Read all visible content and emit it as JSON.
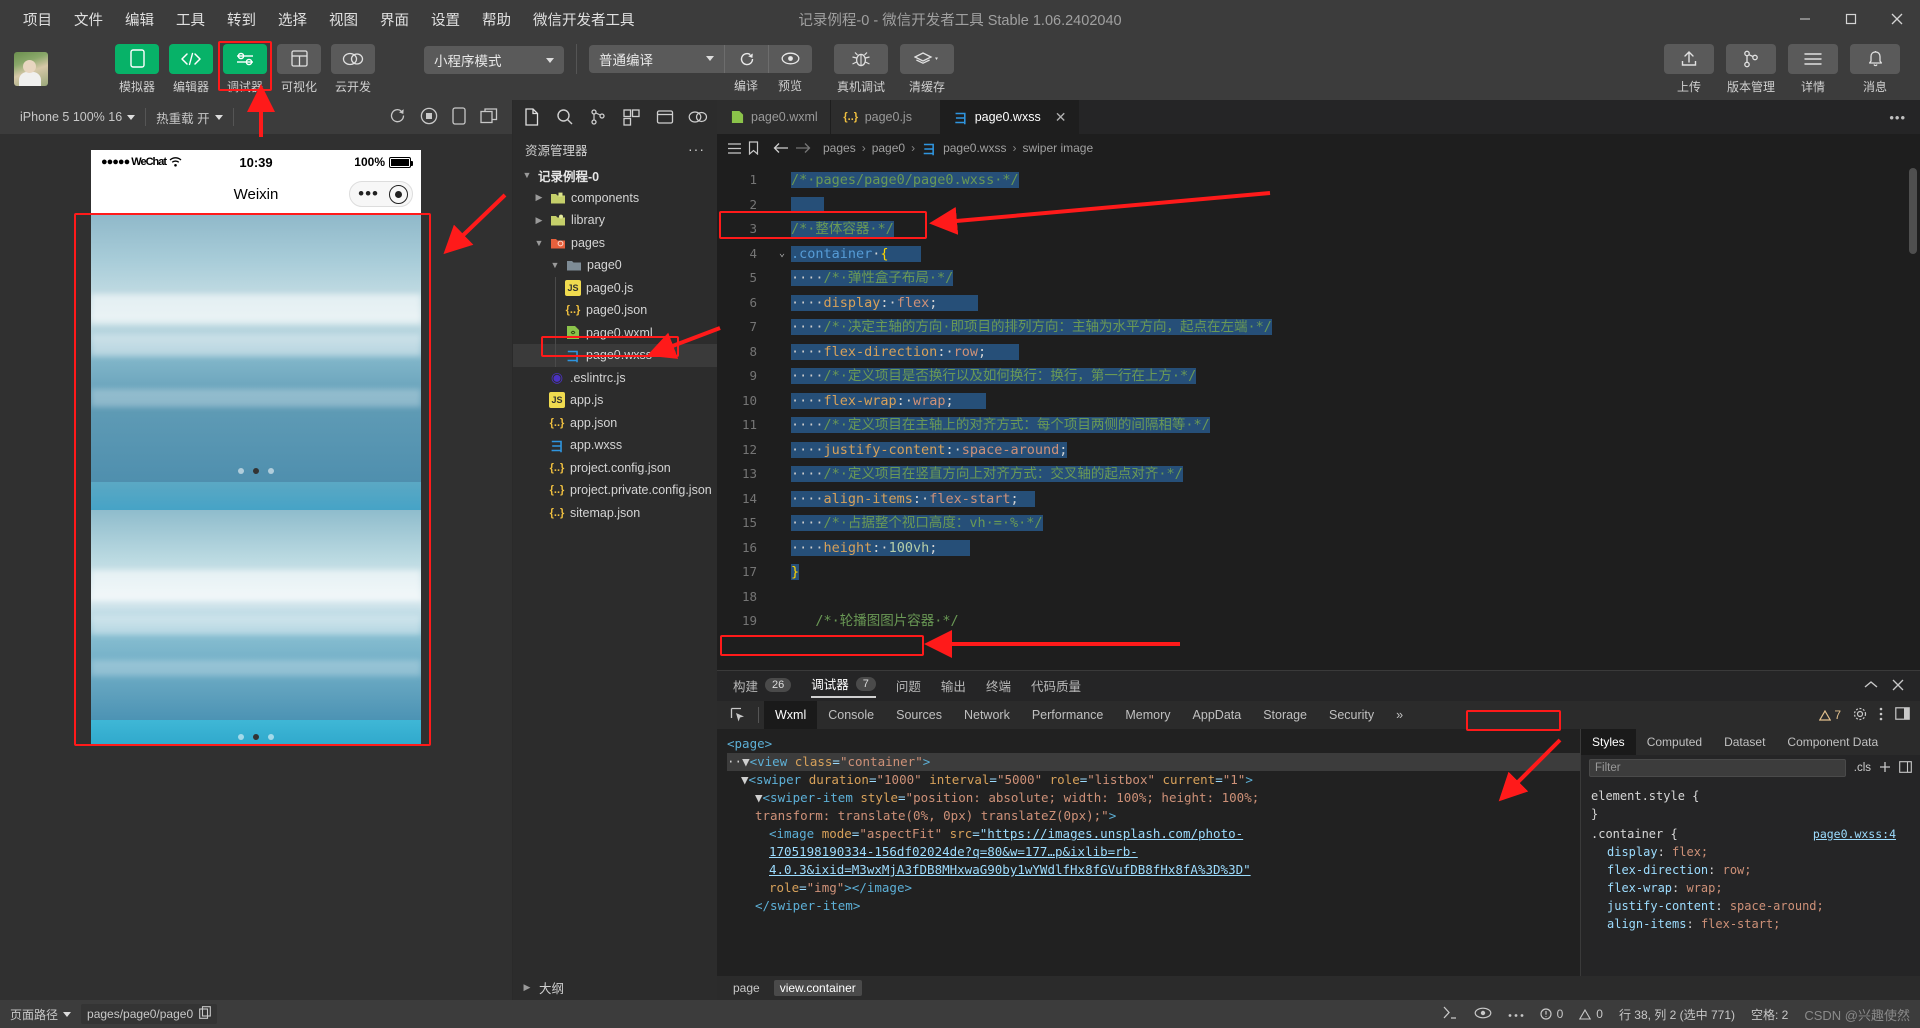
{
  "window": {
    "title": "记录例程-0 - 微信开发者工具 Stable 1.06.2402040",
    "minimize": "—",
    "maximize": "□",
    "close": "✕"
  },
  "menubar": [
    "项目",
    "文件",
    "编辑",
    "工具",
    "转到",
    "选择",
    "视图",
    "界面",
    "设置",
    "帮助",
    "微信开发者工具"
  ],
  "toolbar": {
    "buttons": [
      {
        "label": "模拟器",
        "icon": "phone-icon",
        "green": true
      },
      {
        "label": "编辑器",
        "icon": "code-icon",
        "green": true
      },
      {
        "label": "调试器",
        "icon": "sliders-icon",
        "green": true
      },
      {
        "label": "可视化",
        "icon": "layout-grid-icon",
        "green": false
      },
      {
        "label": "云开发",
        "icon": "cloud-icon",
        "green": false
      }
    ],
    "mode_select": "小程序模式",
    "compile_select": "普通编译",
    "compile_label": "编译",
    "preview_label": "预览",
    "realdevice_label": "真机调试",
    "clearcache_label": "清缓存",
    "right_buttons": [
      {
        "label": "上传",
        "icon": "upload-icon"
      },
      {
        "label": "版本管理",
        "icon": "git-branch-icon"
      },
      {
        "label": "详情",
        "icon": "hamburger-icon"
      },
      {
        "label": "消息",
        "icon": "bell-icon"
      }
    ]
  },
  "simulator": {
    "device_select": "iPhone 5 100% 16",
    "hotreload_select": "热重载 开",
    "refresh_icon": "refresh-icon",
    "stop_icon": "stop-record-icon",
    "phone_icon": "phone-outline-icon",
    "copy_icon": "multiscreen-icon",
    "status_carrier": "●●●●● WeChat",
    "status_time": "10:39",
    "status_battery": "100%",
    "nav_title": "Weixin",
    "dots_menu": "•••"
  },
  "explorer": {
    "tabs": [
      "files-icon",
      "search-icon",
      "scm-icon",
      "extensions-icon",
      "debug-icon",
      "cloud-icon"
    ],
    "header": "资源管理器",
    "more": "···",
    "root": "记录例程-0",
    "items": [
      {
        "name": "components",
        "type": "folder",
        "indent": 1,
        "arrow": "▶"
      },
      {
        "name": "library",
        "type": "folder",
        "indent": 1,
        "arrow": "▶"
      },
      {
        "name": "pages",
        "type": "folder-pages",
        "indent": 1,
        "arrow": "▼"
      },
      {
        "name": "page0",
        "type": "folder-open",
        "indent": 2,
        "arrow": "▼"
      },
      {
        "name": "page0.js",
        "type": "js",
        "indent": 3,
        "arrow": ""
      },
      {
        "name": "page0.json",
        "type": "json",
        "indent": 3,
        "arrow": ""
      },
      {
        "name": "page0.wxml",
        "type": "wxml",
        "indent": 3,
        "arrow": ""
      },
      {
        "name": "page0.wxss",
        "type": "wxss",
        "indent": 3,
        "arrow": "",
        "selected": true
      },
      {
        "name": ".eslintrc.js",
        "type": "eslint",
        "indent": 2,
        "arrow": ""
      },
      {
        "name": "app.js",
        "type": "js",
        "indent": 2,
        "arrow": ""
      },
      {
        "name": "app.json",
        "type": "json",
        "indent": 2,
        "arrow": ""
      },
      {
        "name": "app.wxss",
        "type": "wxss",
        "indent": 2,
        "arrow": ""
      },
      {
        "name": "project.config.json",
        "type": "json",
        "indent": 2,
        "arrow": ""
      },
      {
        "name": "project.private.config.json",
        "type": "json",
        "indent": 2,
        "arrow": ""
      },
      {
        "name": "sitemap.json",
        "type": "json",
        "indent": 2,
        "arrow": ""
      }
    ],
    "outline": "大纲"
  },
  "editor": {
    "tabs": [
      {
        "label": "page0.wxml",
        "type": "wxml",
        "active": false
      },
      {
        "label": "page0.js",
        "type": "js",
        "active": false
      },
      {
        "label": "page0.wxss",
        "type": "wxss",
        "active": true,
        "close": "✕"
      }
    ],
    "tabs_more": "•••",
    "breadcrumb": [
      "pages",
      "page0",
      "page0.wxss",
      "swiper image"
    ],
    "lines": [
      {
        "n": 1,
        "fold": "",
        "html": "<span class=\"hl tok-cmt\">/*·pages/page0/page0.wxss·*/</span>"
      },
      {
        "n": 2,
        "fold": "",
        "html": "<span class=\"hl\">&nbsp;&nbsp;&nbsp;&nbsp;</span>"
      },
      {
        "n": 3,
        "fold": "",
        "html": "<span class=\"hl tok-cmt\">/*·整体容器·*/</span>"
      },
      {
        "n": 4,
        "fold": "⌄",
        "html": "<span class=\"hl\"><span class=\"tok-sel\">.container</span><span class=\"tok-punc\">·</span><span class=\"tok-brace\">{</span>&nbsp;&nbsp;&nbsp;&nbsp;</span>"
      },
      {
        "n": 5,
        "fold": "",
        "html": "<span class=\"hl\">····<span class=\"tok-cmt\">/*·弹性盒子布局·*/</span></span>"
      },
      {
        "n": 6,
        "fold": "",
        "html": "<span class=\"hl\">····<span class=\"tok-prop\">display</span><span class=\"tok-punc\">:·</span><span class=\"tok-val\">flex</span><span class=\"tok-punc\">;</span>&nbsp;&nbsp;&nbsp;&nbsp;&nbsp;</span>"
      },
      {
        "n": 7,
        "fold": "",
        "html": "<span class=\"hl\">····<span class=\"tok-cmt\">/*·决定主轴的方向·即项目的排列方向：主轴为水平方向，起点在左端·*/</span></span>"
      },
      {
        "n": 8,
        "fold": "",
        "html": "<span class=\"hl\">····<span class=\"tok-prop\">flex-direction</span><span class=\"tok-punc\">:·</span><span class=\"tok-val\">row</span><span class=\"tok-punc\">;</span>&nbsp;&nbsp;&nbsp;&nbsp;</span>"
      },
      {
        "n": 9,
        "fold": "",
        "html": "<span class=\"hl\">····<span class=\"tok-cmt\">/*·定义项目是否换行以及如何换行：换行，第一行在上方·*/</span></span>"
      },
      {
        "n": 10,
        "fold": "",
        "html": "<span class=\"hl\">····<span class=\"tok-prop\">flex-wrap</span><span class=\"tok-punc\">:·</span><span class=\"tok-val\">wrap</span><span class=\"tok-punc\">;</span>&nbsp;&nbsp;&nbsp;&nbsp;</span>"
      },
      {
        "n": 11,
        "fold": "",
        "html": "<span class=\"hl\">····<span class=\"tok-cmt\">/*·定义项目在主轴上的对齐方式：每个项目两侧的间隔相等·*/</span></span>"
      },
      {
        "n": 12,
        "fold": "",
        "html": "<span class=\"hl\">····<span class=\"tok-prop\">justify-content</span><span class=\"tok-punc\">:·</span><span class=\"tok-val\">space-around</span><span class=\"tok-punc\">;</span></span>"
      },
      {
        "n": 13,
        "fold": "",
        "html": "<span class=\"hl\">····<span class=\"tok-cmt\">/*·定义项目在竖直方向上对齐方式：交叉轴的起点对齐·*/</span></span>"
      },
      {
        "n": 14,
        "fold": "",
        "html": "<span class=\"hl\">····<span class=\"tok-prop\">align-items</span><span class=\"tok-punc\">:·</span><span class=\"tok-val\">flex-start</span><span class=\"tok-punc\">;</span>&nbsp;&nbsp;</span>"
      },
      {
        "n": 15,
        "fold": "",
        "html": "<span class=\"hl\">····<span class=\"tok-cmt\">/*·占据整个视口高度：vh·=·%·*/</span></span>"
      },
      {
        "n": 16,
        "fold": "",
        "html": "<span class=\"hl\">····<span class=\"tok-prop\">height</span><span class=\"tok-punc\">:·</span><span class=\"tok-num\">100vh</span><span class=\"tok-punc\">;</span>&nbsp;&nbsp;&nbsp;&nbsp;</span>"
      },
      {
        "n": 17,
        "fold": "",
        "html": "<span class=\"hl tok-brace\">}</span>"
      },
      {
        "n": 18,
        "fold": "",
        "html": ""
      },
      {
        "n": 19,
        "fold": "",
        "html": "<span class=\"tok-cmt\">&nbsp;&nbsp;&nbsp;/*·轮播图图片容器·*/</span>"
      }
    ]
  },
  "devtools": {
    "head_tabs": [
      {
        "label": "构建",
        "badge": "26",
        "active": false
      },
      {
        "label": "调试器",
        "badge": "7",
        "active": true
      },
      {
        "label": "问题",
        "badge": "",
        "active": false
      },
      {
        "label": "输出",
        "badge": "",
        "active": false
      },
      {
        "label": "终端",
        "badge": "",
        "active": false
      },
      {
        "label": "代码质量",
        "badge": "",
        "active": false
      }
    ],
    "collapse_icon": "chevron-up-icon",
    "close_icon": "close-icon",
    "panel_tabs": [
      "Wxml",
      "Console",
      "Sources",
      "Network",
      "Performance",
      "Memory",
      "AppData",
      "Storage",
      "Security"
    ],
    "panel_active": "Wxml",
    "overflow": "»",
    "warning_count": "7",
    "settings_icon": "gear-icon",
    "kebab_icon": "kebab-icon",
    "dock_icon": "dock-icon",
    "picker_icon": "element-picker-icon",
    "wxml_lines": [
      {
        "indent": 0,
        "html": "<span class=\"t-tag\">&lt;page&gt;</span>"
      },
      {
        "indent": 0,
        "sel": true,
        "html": "<span class=\"t-plain\">··</span><span class=\"t-plain\">▼</span><span class=\"t-tag\">&lt;view</span> <span class=\"t-attr\">class</span>=<span class=\"t-str\">\"container\"</span><span class=\"t-tag\">&gt;</span>"
      },
      {
        "indent": 1,
        "html": "<span class=\"t-plain\">▼</span><span class=\"t-tag\">&lt;swiper</span> <span class=\"t-attr\">duration</span>=<span class=\"t-str\">\"1000\"</span> <span class=\"t-attr\">interval</span>=<span class=\"t-str\">\"5000\"</span> <span class=\"t-attr\">role</span>=<span class=\"t-str\">\"listbox\"</span> <span class=\"t-attr\">current</span>=<span class=\"t-str\">\"1\"</span><span class=\"t-tag\">&gt;</span>"
      },
      {
        "indent": 2,
        "html": "<span class=\"t-plain\">▼</span><span class=\"t-tag\">&lt;swiper-item</span> <span class=\"t-attr\">style</span>=<span class=\"t-str\">\"position: absolute; width: 100%; height: 100%;</span>"
      },
      {
        "indent": 2,
        "html": "<span class=\"t-str\">transform: translate(0%, 0px) translateZ(0px);\"</span><span class=\"t-tag\">&gt;</span>"
      },
      {
        "indent": 3,
        "html": "<span class=\"t-tag\">&lt;image</span> <span class=\"t-attr\">mode</span>=<span class=\"t-str\">\"aspectFit\"</span> <span class=\"t-attr\">src</span>=<span class=\"t-link\">\"https://images.unsplash.com/photo-</span>"
      },
      {
        "indent": 3,
        "html": "<span class=\"t-link\">1705198190334-156df02024de?q=80&amp;w=177…p&amp;ixlib=rb-</span>"
      },
      {
        "indent": 3,
        "html": "<span class=\"t-link\">4.0.3&amp;ixid=M3wxMjA3fDB8MHxwaG90by1wYWdlfHx8fGVufDB8fHx8fA%3D%3D\"</span>"
      },
      {
        "indent": 3,
        "html": "<span class=\"t-attr\">role</span>=<span class=\"t-str\">\"img\"</span><span class=\"t-tag\">&gt;&lt;/image&gt;</span>"
      },
      {
        "indent": 2,
        "html": "<span class=\"t-tag\">&lt;/swiper-item&gt;</span>"
      }
    ],
    "crumbs": [
      "page",
      "view.container"
    ],
    "styles": {
      "tabs": [
        "Styles",
        "Computed",
        "Dataset",
        "Component Data"
      ],
      "active": "Styles",
      "filter_placeholder": "Filter",
      "cls_btn": ".cls",
      "plus_icon": "plus-icon",
      "panel_icon": "panel-icon",
      "rules": [
        {
          "selector": "element.style {",
          "source": "",
          "decls": [],
          "close": "}"
        },
        {
          "selector": ".container {",
          "source": "page0.wxss:4",
          "decls": [
            {
              "prop": "display",
              "value": "flex;"
            },
            {
              "prop": "flex-direction",
              "value": "row;"
            },
            {
              "prop": "flex-wrap",
              "value": "wrap;"
            },
            {
              "prop": "justify-content",
              "value": "space-around;"
            },
            {
              "prop": "align-items",
              "value": "flex-start;"
            }
          ],
          "close": ""
        }
      ]
    }
  },
  "statusbar": {
    "path_label": "页面路径",
    "path_value": "pages/page0/page0",
    "copy_icon": "copy-icon",
    "settings_icon": "settings-icon",
    "eye_icon": "eye-icon",
    "more_icon": "more-icon",
    "errors": "0",
    "warnings": "0",
    "cursor": "行 38, 列 2 (选中 771)",
    "encoding": "空格: 2",
    "watermark": "CSDN @兴趣使然"
  },
  "colors": {
    "accent_green": "#07b268",
    "annotation_red": "#ff1a1a",
    "editor_bg": "#1e1e1e",
    "chrome_bg": "#3c3c3c"
  }
}
